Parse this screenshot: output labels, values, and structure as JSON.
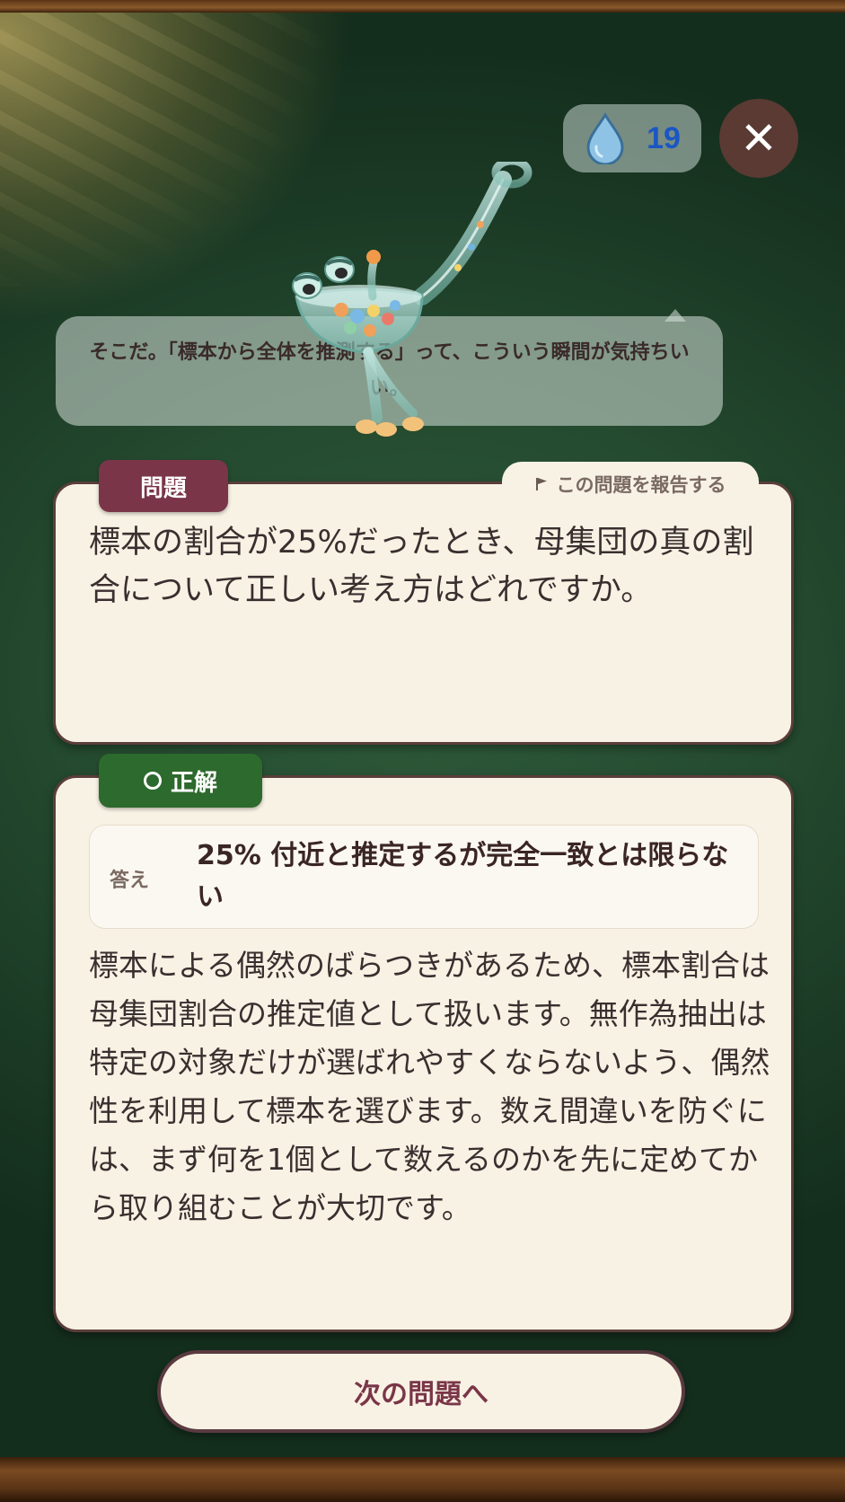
{
  "hud": {
    "drops_count": "19",
    "drop_icon": "water-drop-icon",
    "close_icon": "close-icon",
    "close_glyph": "✕"
  },
  "mascot": {
    "speech": "そこだ。「標本から全体を推測する」って、こういう瞬間が気持ちいい。"
  },
  "question": {
    "tab_label": "問題",
    "report_label": "この問題を報告する",
    "report_icon": "flag-icon",
    "text": "標本の割合が25%だったとき、母集団の真の割合について正しい考え方はどれですか。"
  },
  "result": {
    "tab_label": "正解",
    "tab_icon": "circle-icon",
    "answer_label": "答え",
    "answer_text": "25% 付近と推定するが完全一致とは限らない",
    "explanation": "標本による偶然のばらつきがあるため、標本割合は母集団割合の推定値として扱います。無作為抽出は特定の対象だけが選ばれやすくならないよう、偶然性を利用して標本を選びます。数え間違いを防ぐには、まず何を1個として数えるのかを先に定めてから取り組むことが大切です。"
  },
  "footer": {
    "next_label": "次の問題へ"
  },
  "colors": {
    "board_green": "#244a2f",
    "card_bg": "#f8f2e4",
    "question_tab": "#7a3548",
    "correct_tab": "#2d6a2d",
    "drops_count": "#1a56c4",
    "close_bg": "#5a3a33"
  }
}
